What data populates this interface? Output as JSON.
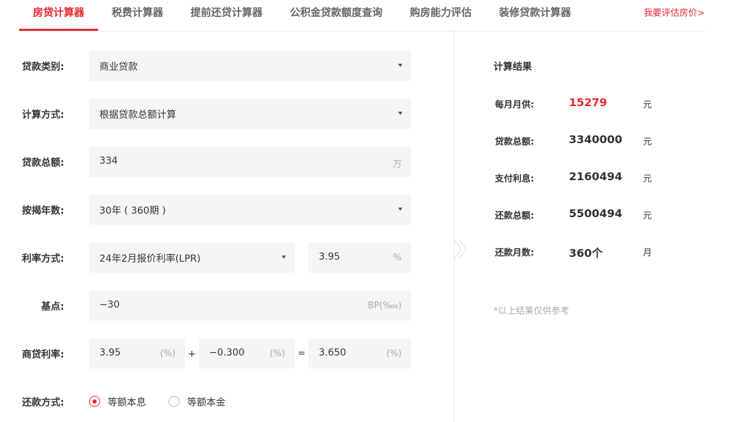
{
  "tabs": [
    {
      "label": "房贷计算器",
      "active": true
    },
    {
      "label": "税费计算器"
    },
    {
      "label": "提前还贷计算器"
    },
    {
      "label": "公积金贷款额度查询"
    },
    {
      "label": "购房能力评估"
    },
    {
      "label": "装修贷款计算器"
    }
  ],
  "tab_link": "我要评估房价>",
  "form": {
    "loan_type": {
      "label": "贷款类别:",
      "value": "商业贷款"
    },
    "calc_method": {
      "label": "计算方式:",
      "value": "根据贷款总额计算"
    },
    "loan_amount": {
      "label": "贷款总额:",
      "value": "334",
      "unit": "万"
    },
    "years": {
      "label": "按揭年数:",
      "value": "30年 ( 360期 )"
    },
    "rate_method": {
      "label": "利率方式:",
      "value": "24年2月报价利率(LPR)",
      "rate": "3.95",
      "unit": "%"
    },
    "basis_point": {
      "label": "基点:",
      "value": "−30",
      "unit": "BP(‱)"
    },
    "commercial_rate": {
      "label": "商贷利率:",
      "base": "3.95",
      "base_unit": "(%)",
      "plus": "+",
      "adjust": "−0.300",
      "adjust_unit": "(%)",
      "equals": "=",
      "result": "3.650",
      "result_unit": "(%)"
    },
    "repay_method": {
      "label": "还款方式:",
      "options": [
        {
          "label": "等额本息",
          "checked": true
        },
        {
          "label": "等额本金",
          "checked": false
        }
      ]
    }
  },
  "results": {
    "title": "计算结果",
    "rows": [
      {
        "label": "每月月供:",
        "value": "15279",
        "unit": "元"
      },
      {
        "label": "贷款总额:",
        "value": "3340000",
        "unit": "元"
      },
      {
        "label": "支付利息:",
        "value": "2160494",
        "unit": "元"
      },
      {
        "label": "还款总额:",
        "value": "5500494",
        "unit": "元"
      },
      {
        "label": "还款月数:",
        "value": "360个",
        "unit": "月"
      }
    ],
    "note": "*以上结果仅供参考"
  },
  "colors": {
    "accent": "#e8262c",
    "field_bg": "#f5f5f5",
    "muted": "#aaaaaa"
  }
}
